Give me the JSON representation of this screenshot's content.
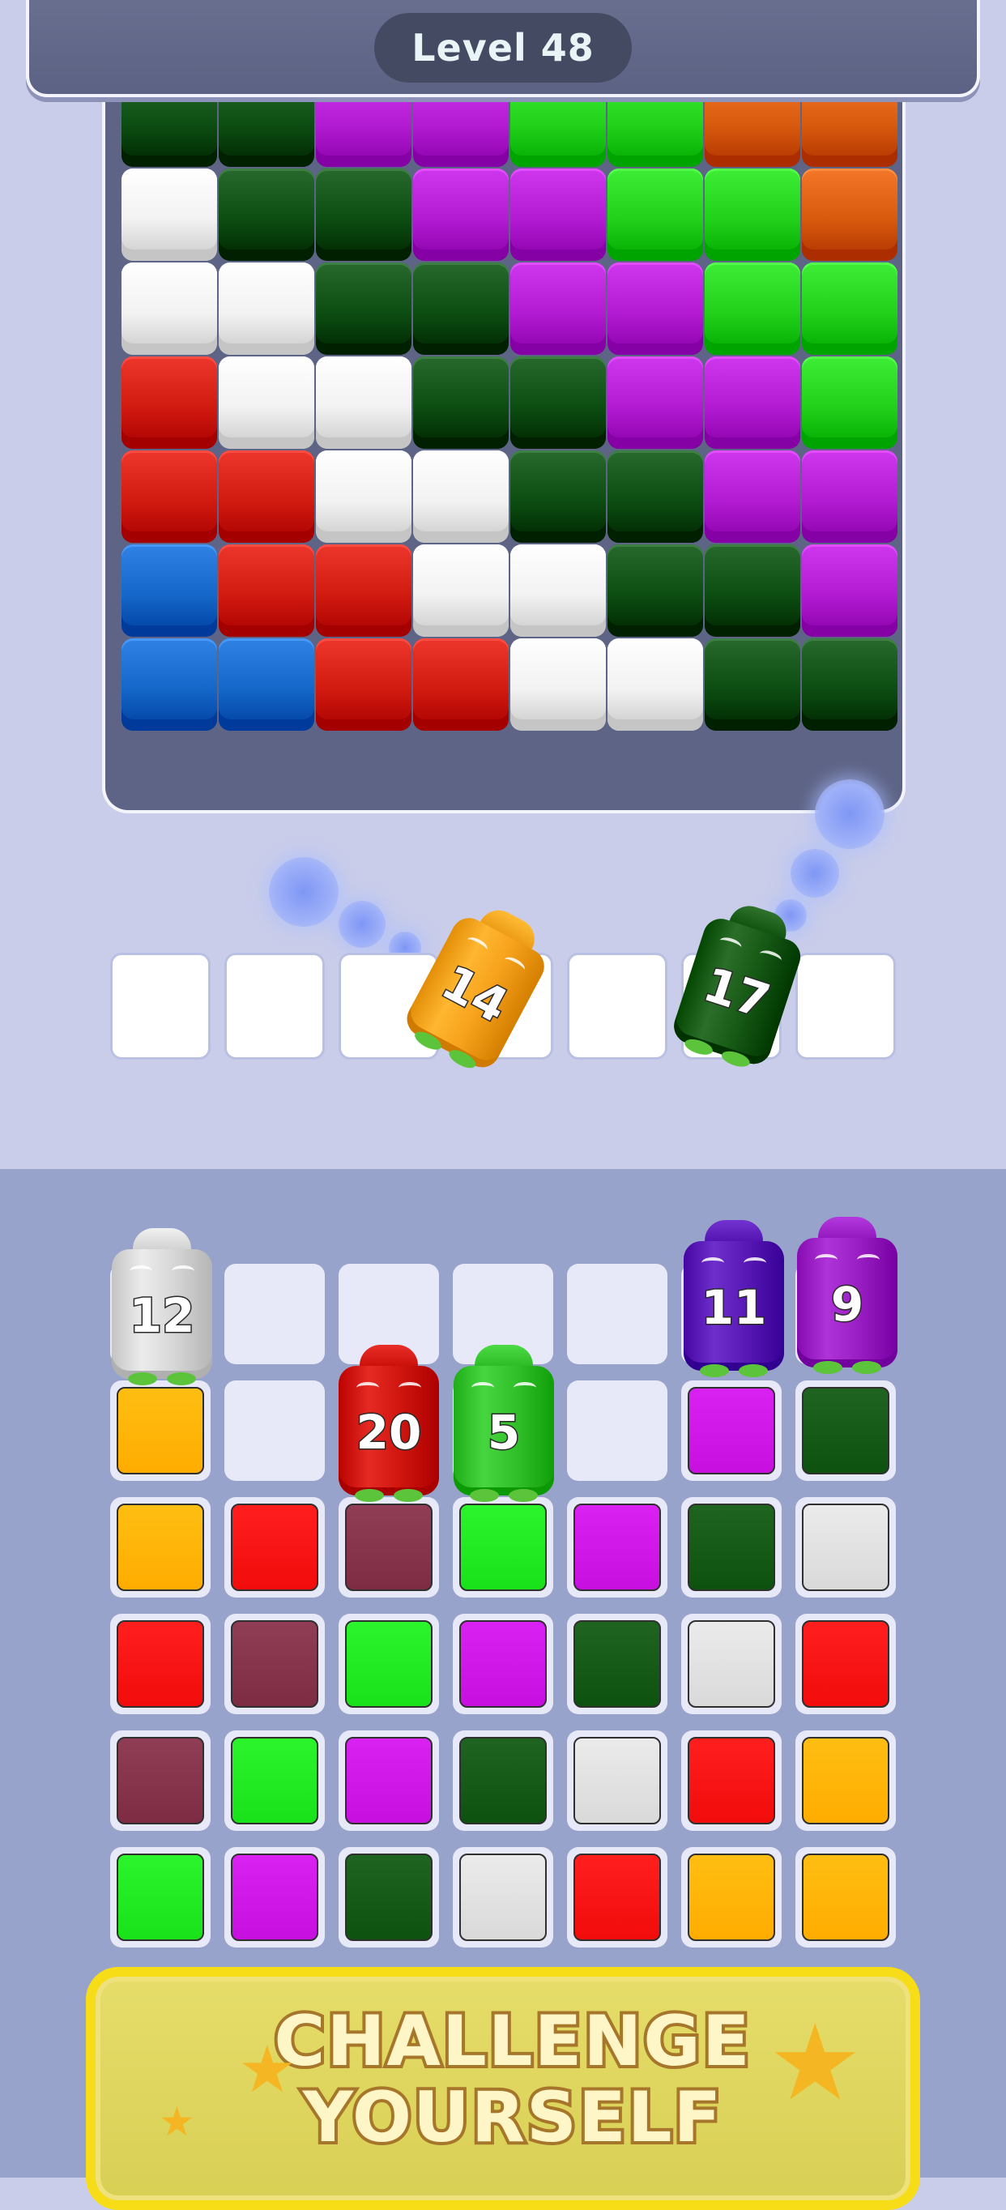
{
  "header": {
    "level_label": "Level 48"
  },
  "colors": {
    "W": "#f2f2f2",
    "D": "#0c4d12",
    "P": "#b21bd2",
    "L": "#22d11a",
    "O": "#d85a0d",
    "R": "#d11a10",
    "B": "#1467c8"
  },
  "board": {
    "rows": [
      [
        "D",
        "D",
        "P",
        "P",
        "L",
        "L",
        "O",
        "O"
      ],
      [
        "W",
        "D",
        "D",
        "P",
        "P",
        "L",
        "L",
        "O"
      ],
      [
        "W",
        "W",
        "D",
        "D",
        "P",
        "P",
        "L",
        "L"
      ],
      [
        "R",
        "W",
        "W",
        "D",
        "D",
        "P",
        "P",
        "L"
      ],
      [
        "R",
        "R",
        "W",
        "W",
        "D",
        "D",
        "P",
        "P"
      ],
      [
        "B",
        "R",
        "R",
        "W",
        "W",
        "D",
        "D",
        "P"
      ],
      [
        "B",
        "B",
        "R",
        "R",
        "W",
        "W",
        "D",
        "D"
      ]
    ]
  },
  "queue": {
    "slot_count": 7,
    "bottles": [
      {
        "number": "14",
        "color": "#f7a21c",
        "icon": "orange-bottle"
      },
      {
        "number": "17",
        "color": "#175a16",
        "icon": "dark-green-bottle"
      }
    ]
  },
  "bottles_top": [
    {
      "number": "12",
      "color": "#d8d8d8",
      "icon": "white-bottle"
    },
    {
      "number": "20",
      "color": "#d0160f",
      "icon": "red-bottle"
    },
    {
      "number": "5",
      "color": "#33c12c",
      "icon": "green-bottle"
    },
    {
      "number": "11",
      "color": "#5a1ab8",
      "icon": "indigo-bottle"
    },
    {
      "number": "9",
      "color": "#9a1fc4",
      "icon": "purple-bottle"
    }
  ],
  "lower_grid": {
    "rows": [
      [
        null,
        null,
        null,
        null,
        null,
        null,
        null
      ],
      [
        "#ffac00",
        null,
        null,
        null,
        null,
        "#c70fe0",
        "#0d520e"
      ],
      [
        "#ffac00",
        "#f20c0c",
        "#7e2b44",
        "#19e21a",
        "#c70fe0",
        "#0d520e",
        "#d9d9d9"
      ],
      [
        "#f20c0c",
        "#7e2b44",
        "#19e21a",
        "#c70fe0",
        "#0d520e",
        "#d9d9d9",
        "#f20c0c"
      ],
      [
        "#7e2b44",
        "#19e21a",
        "#c70fe0",
        "#0d520e",
        "#d9d9d9",
        "#f20c0c",
        "#ffac00"
      ],
      [
        "#19e21a",
        "#c70fe0",
        "#0d520e",
        "#d9d9d9",
        "#f20c0c",
        "#ffac00",
        "#ffac00"
      ]
    ]
  },
  "banner": {
    "line1": "CHALLENGE",
    "line2": "YOURSELF"
  }
}
